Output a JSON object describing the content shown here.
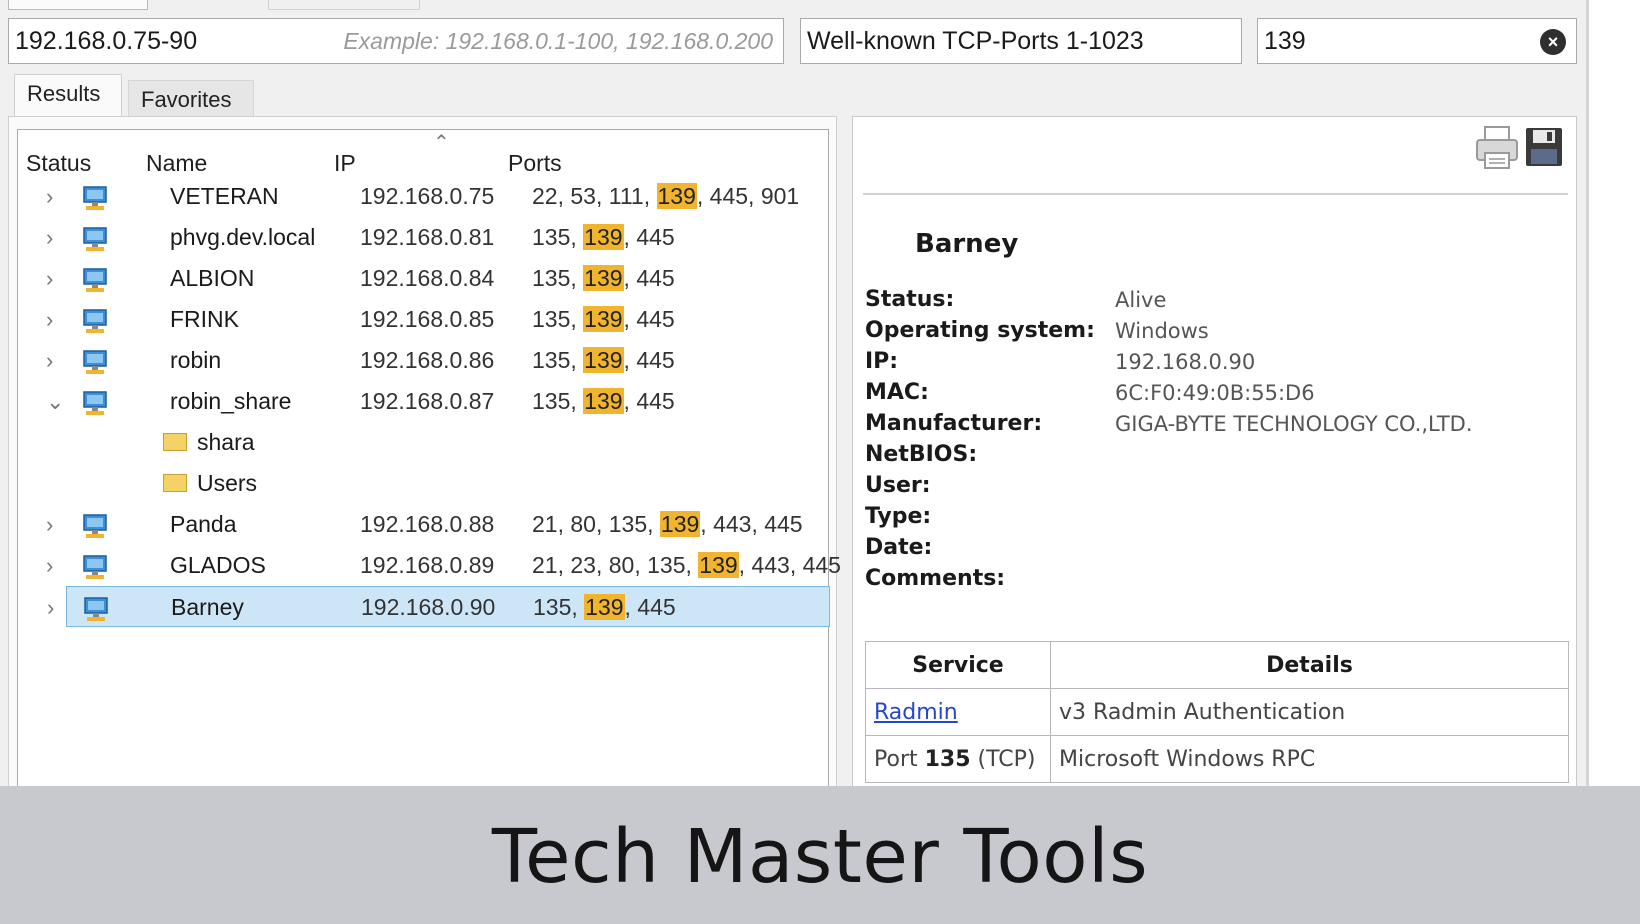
{
  "scan_bar": {
    "ip_range_value": "192.168.0.75-90",
    "ip_range_hint": "Example: 192.168.0.1-100, 192.168.0.200",
    "port_preset": "Well-known TCP-Ports 1-1023",
    "port_filter_value": "139"
  },
  "tabs": [
    {
      "label": "Results",
      "active": true
    },
    {
      "label": "Favorites",
      "active": false
    }
  ],
  "results": {
    "columns": [
      "Status",
      "Name",
      "IP",
      "Ports"
    ],
    "highlight_port": "139",
    "rows": [
      {
        "name": "VETERAN",
        "ip": "192.168.0.75",
        "ports": [
          "22",
          "53",
          "111",
          "139",
          "445",
          "901"
        ],
        "expanded": false
      },
      {
        "name": "phvg.dev.local",
        "ip": "192.168.0.81",
        "ports": [
          "135",
          "139",
          "445"
        ],
        "expanded": false
      },
      {
        "name": "ALBION",
        "ip": "192.168.0.84",
        "ports": [
          "135",
          "139",
          "445"
        ],
        "expanded": false
      },
      {
        "name": "FRINK",
        "ip": "192.168.0.85",
        "ports": [
          "135",
          "139",
          "445"
        ],
        "expanded": false
      },
      {
        "name": "robin",
        "ip": "192.168.0.86",
        "ports": [
          "135",
          "139",
          "445"
        ],
        "expanded": false
      },
      {
        "name": "robin_share",
        "ip": "192.168.0.87",
        "ports": [
          "135",
          "139",
          "445"
        ],
        "expanded": true,
        "children": [
          "shara",
          "Users"
        ]
      },
      {
        "name": "Panda",
        "ip": "192.168.0.88",
        "ports": [
          "21",
          "80",
          "135",
          "139",
          "443",
          "445"
        ],
        "expanded": false
      },
      {
        "name": "GLADOS",
        "ip": "192.168.0.89",
        "ports": [
          "21",
          "23",
          "80",
          "135",
          "139",
          "443",
          "445"
        ],
        "expanded": false
      },
      {
        "name": "Barney",
        "ip": "192.168.0.90",
        "ports": [
          "135",
          "139",
          "445"
        ],
        "expanded": false,
        "selected": true
      }
    ]
  },
  "details": {
    "host": "Barney",
    "fields": [
      {
        "label": "Status:",
        "value": "Alive"
      },
      {
        "label": "Operating system:",
        "value": "Windows"
      },
      {
        "label": "IP:",
        "value": "192.168.0.90"
      },
      {
        "label": "MAC:",
        "value": "6C:F0:49:0B:55:D6"
      },
      {
        "label": "Manufacturer:",
        "value": "GIGA-BYTE TECHNOLOGY CO.,LTD."
      },
      {
        "label": "NetBIOS:",
        "value": ""
      },
      {
        "label": "User:",
        "value": ""
      },
      {
        "label": "Type:",
        "value": ""
      },
      {
        "label": "Date:",
        "value": ""
      },
      {
        "label": "Comments:",
        "value": ""
      }
    ],
    "service_table": {
      "headers": [
        "Service",
        "Details"
      ],
      "rows": [
        {
          "service": "Radmin",
          "service_is_link": true,
          "details": "v3 Radmin Authentication"
        },
        {
          "service_prefix": "Port ",
          "service_port": "135",
          "service_suffix": " (TCP)",
          "details": "Microsoft Windows RPC"
        }
      ]
    },
    "icons": [
      "print-icon",
      "save-icon"
    ]
  },
  "caption": "Tech Master Tools",
  "colors": {
    "port_highlight": "#f1b42f",
    "selection": "#cde6f7",
    "link": "#2448c8",
    "caption_bg": "#c8c9ce"
  }
}
